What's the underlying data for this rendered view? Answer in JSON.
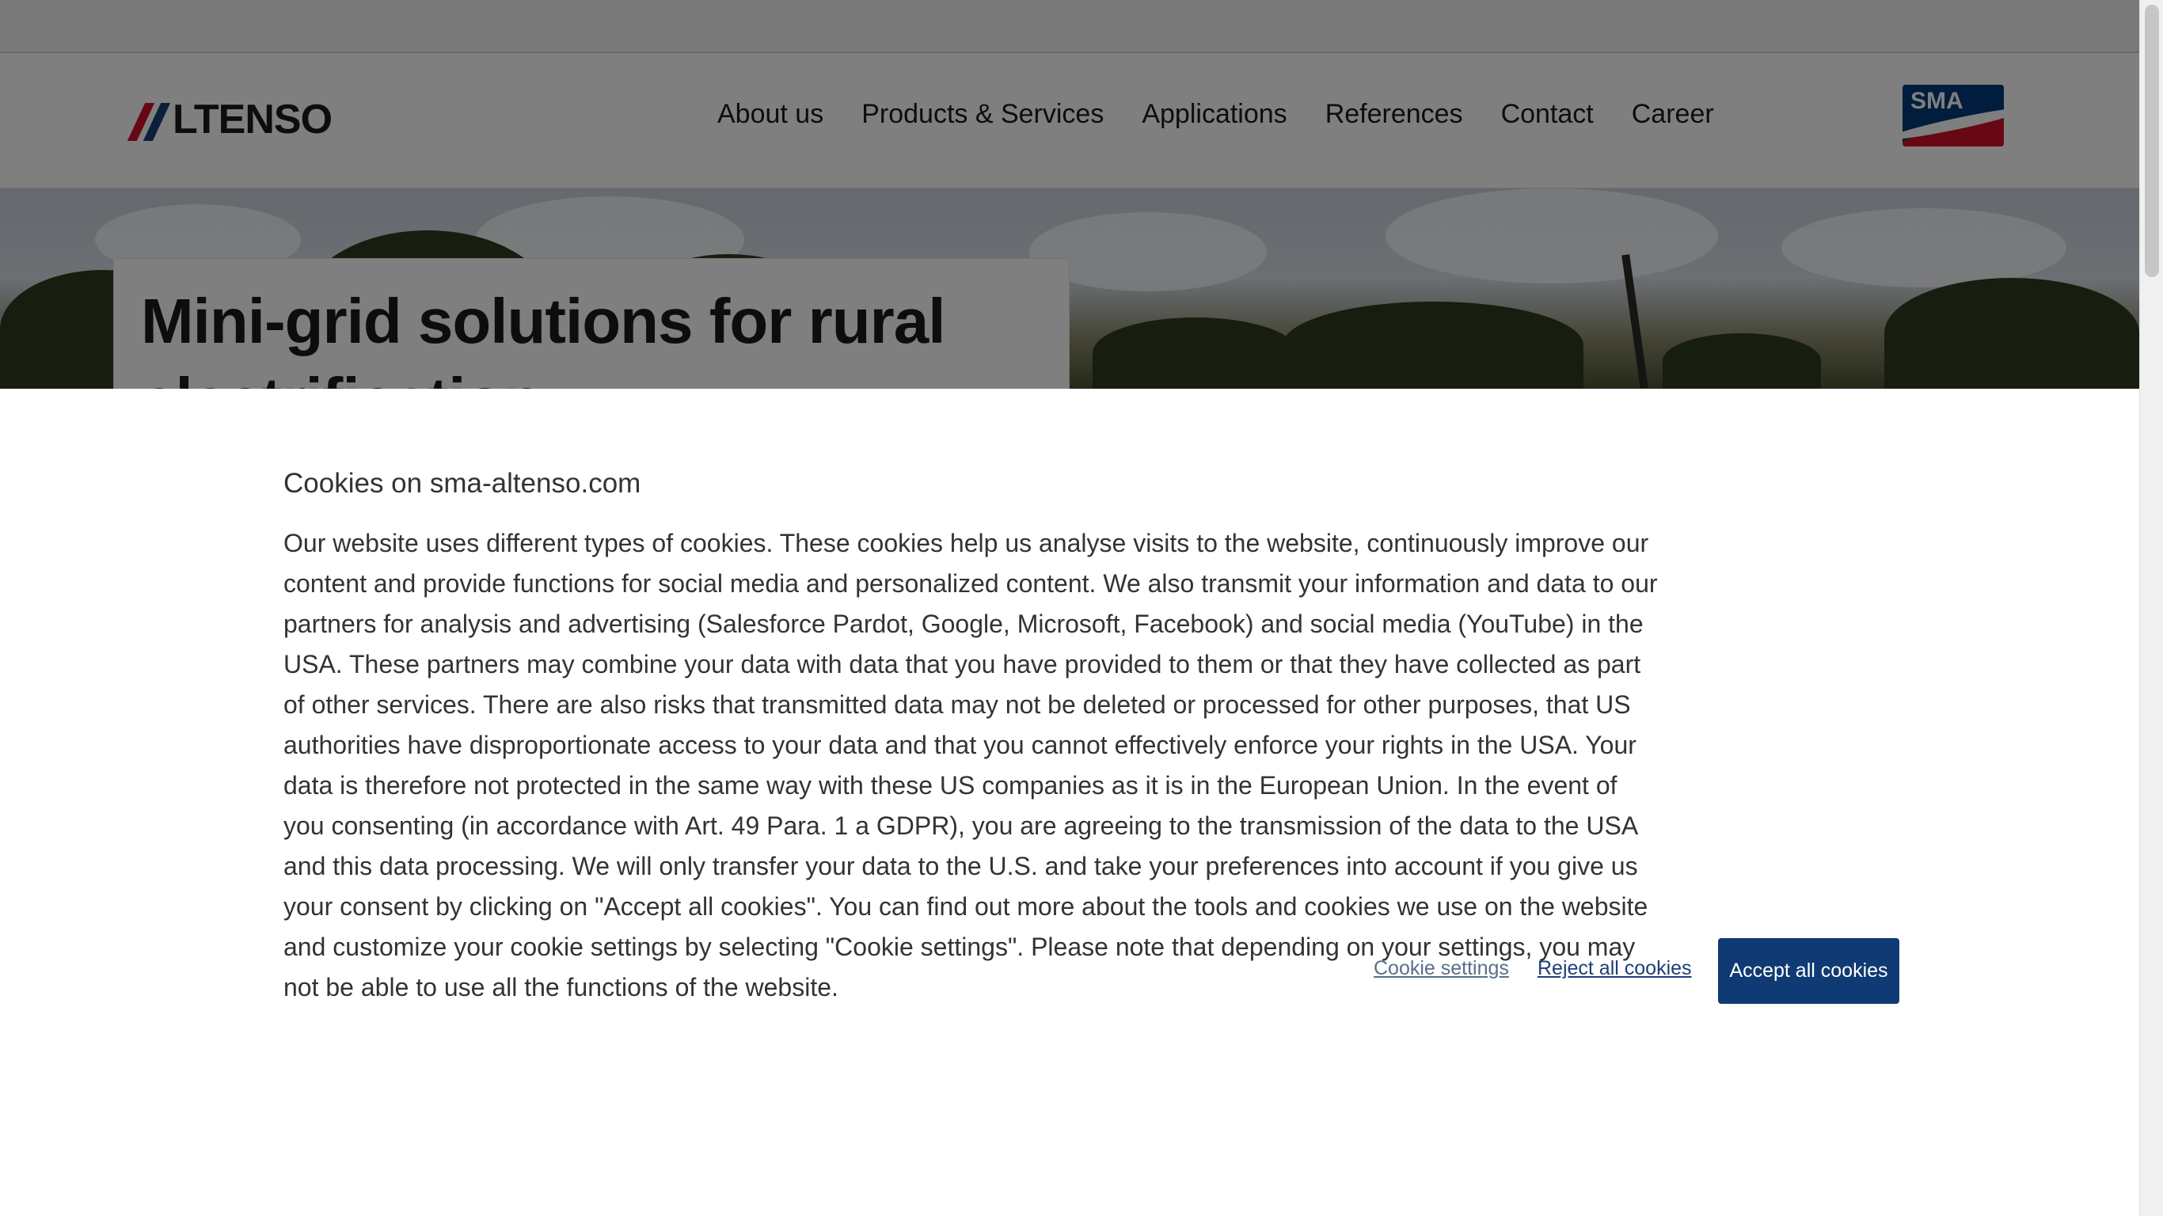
{
  "header": {
    "logo_text": "LTENSO",
    "brand_badge": "SMA",
    "nav": [
      {
        "label": "About us"
      },
      {
        "label": "Products & Services"
      },
      {
        "label": "Applications"
      },
      {
        "label": "References"
      },
      {
        "label": "Contact"
      },
      {
        "label": "Career"
      }
    ]
  },
  "hero": {
    "title_line1": "Mini-grid solutions for rural",
    "title_line2": "electrification"
  },
  "cookie_banner": {
    "title": "Cookies on sma-altenso.com",
    "body": "Our website uses different types of cookies. These cookies help us analyse visits to the website, continuously improve our content and provide functions for social media and personalized content. We also transmit your information and data to our partners for analysis and advertising (Salesforce Pardot, Google, Microsoft, Facebook) and social media (YouTube) in the USA. These partners may combine your data with data that you have provided to them or that they have collected as part of other services. There are also risks that transmitted data may not be deleted or processed for other purposes, that US authorities have disproportionate access to your data and that you cannot effectively enforce your rights in the USA. Your data is therefore not protected in the same way with these US companies as it is in the European Union. In the event of you consenting (in accordance with Art. 49 Para. 1 a GDPR), you are agreeing to the transmission of the data to the USA and this data processing. We will only transfer your data to the U.S. and take your preferences into account if you give us your consent by clicking on \"Accept all cookies\". You can find out more about the tools and cookies we use on the website and customize your cookie settings by selecting \"Cookie settings\". Please note that depending on your settings, you may not be able to use all the functions of the website.",
    "settings_label": "Cookie settings",
    "reject_label": "Reject all cookies",
    "accept_label": "Accept all cookies"
  },
  "colors": {
    "accent": "#103a73",
    "brand_red": "#d0112b",
    "overlay": "rgba(0,0,0,0.5)"
  },
  "icons": [
    "altenso-logo-mark",
    "sma-logo"
  ]
}
